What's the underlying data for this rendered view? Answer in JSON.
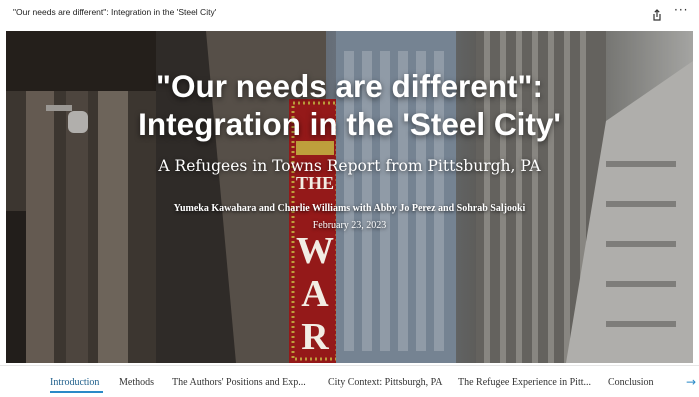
{
  "window": {
    "title": "\"Our needs are different\": Integration in the 'Steel City'",
    "share_icon": "share-icon",
    "more_icon": "more-icon",
    "more_glyph": "···"
  },
  "hero": {
    "headline_line1": "\"Our needs are different\":",
    "headline_line2": "Integration in the 'Steel City'",
    "subtitle": "A Refugees in Towns Report from Pittsburgh, PA",
    "authors": "Yumeka Kawahara and Charlie Williams with Abby Jo Perez and Sohrab Saljooki",
    "date": "February 23, 2023",
    "sign_letters": [
      "W",
      "A",
      "R"
    ],
    "sign_top_text": "THE"
  },
  "nav": {
    "items": [
      {
        "label": "Introduction",
        "active": true
      },
      {
        "label": "Methods",
        "active": false
      },
      {
        "label": "The Authors' Positions and Exp...",
        "active": false
      },
      {
        "label": "City Context: Pittsburgh, PA",
        "active": false
      },
      {
        "label": "The Refugee Experience in Pitt...",
        "active": false
      },
      {
        "label": "Conclusion",
        "active": false
      }
    ],
    "next_icon": "arrow-right-icon",
    "accent_color": "#2a8ac7"
  }
}
